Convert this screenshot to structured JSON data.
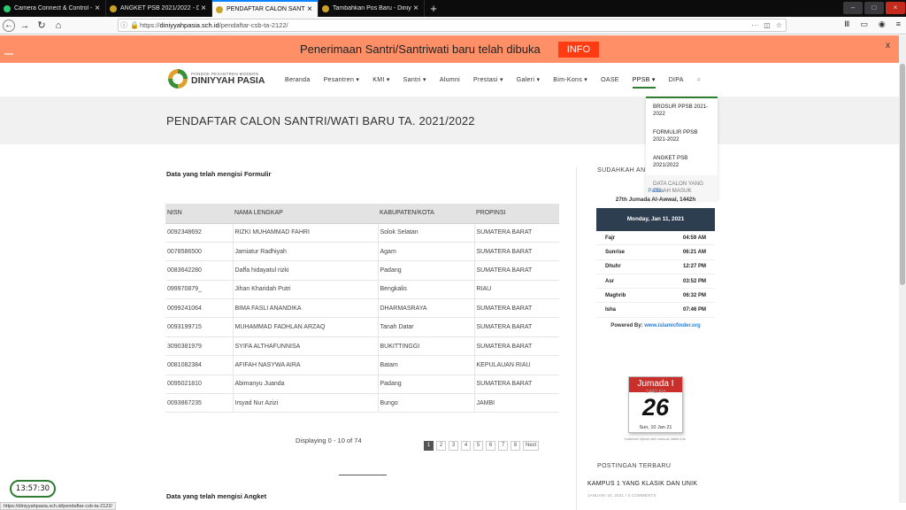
{
  "browser": {
    "tabs": [
      {
        "label": "Camera Connect & Control - A",
        "color": "#2ecc71",
        "active": false
      },
      {
        "label": "ANGKET PSB 2021/2022 - Diniy",
        "color": "#c9a227",
        "active": false
      },
      {
        "label": "PENDAFTAR CALON SANTRI/",
        "color": "#c9a227",
        "active": true
      },
      {
        "label": "Tambahkan Pos Baru - Diniyy",
        "color": "#c9a227",
        "active": false
      }
    ],
    "url_prefix": "https://",
    "url_host": "diniyyahpasia.sch.id",
    "url_path": "/pendaftar-csb-ta-2122/",
    "new_tab": "+",
    "status_url": "https://diniyyahpasia.sch.id/pendaftar-csb-ta-2122/"
  },
  "banner": {
    "text": "Penerimaan Santri/Santriwati baru telah dibuka",
    "button": "INFO",
    "close": "x"
  },
  "logo": {
    "small": "PONDOK PESANTREN MODERN",
    "big": "DINIYYAH PASIA"
  },
  "menu": [
    "Beranda",
    "Pesantren ▾",
    "KMI ▾",
    "Santri ▾",
    "Alumni",
    "Prestasi ▾",
    "Galeri ▾",
    "Bim-Kons ▾",
    "OASE",
    "PPSB ▾",
    "DIPA"
  ],
  "dropdown": [
    "BROSUR PPSB 2021-2022",
    "FORMULIR PPSB 2021-2022",
    "ANGKET PSB 2021/2022",
    "DATA CALON YANG TELAH MASUK"
  ],
  "page_title": "PENDAFTAR CALON SANTRI/WATI BARU TA. 2021/2022",
  "section_form": "Data yang telah mengisi Formulir",
  "section_angket": "Data yang telah mengisi Angket",
  "table": {
    "headers": [
      "NISN",
      "NAMA LENGKAP",
      "KABUPATEN/KOTA",
      "PROPINSI"
    ],
    "rows": [
      [
        "0092348692",
        "RIZKI MUHAMMAD FAHRI",
        "Solok Selatan",
        "SUMATERA BARAT"
      ],
      [
        "0078586500",
        "Jamiatur Radhiyah",
        "Agam",
        "SUMATERA BARAT"
      ],
      [
        "0083642280",
        "Daffa hidayatul rizki",
        "Padang",
        "SUMATERA BARAT"
      ],
      [
        "099970879_",
        "Jihan Kharidah Putri",
        "Bengkalis",
        "RIAU"
      ],
      [
        "0099241064",
        "BIMA FASLI ANANDIKA",
        "DHARMASRAYA",
        "SUMATERA BARAT"
      ],
      [
        "0093199715",
        "MUHAMMAD FADHLAN ARZAQ",
        "Tanah Datar",
        "SUMATERA BARAT"
      ],
      [
        "3090381979",
        "SYIFA ALTHAFUNNISA",
        "BUKITTINGGI",
        "SUMATERA BARAT"
      ],
      [
        "0081082384",
        "AFIFAH NASYWA AIRA",
        "Batam",
        "KEPULAUAN RIAU"
      ],
      [
        "0095021810",
        "Abimanyu Juanda",
        "Padang",
        "SUMATERA BARAT"
      ],
      [
        "0093867235",
        "Irsyad Nur Azizi",
        "Bungo",
        "JAMBI"
      ]
    ]
  },
  "displaying": "Displaying 0 - 10 of 74",
  "pager": [
    "1",
    "2",
    "3",
    "4",
    "5",
    "6",
    "7",
    "8",
    "Next"
  ],
  "pager_current": "1",
  "sidebar": {
    "heading": "SUDAHKAH AN",
    "location": "Padan",
    "hijri": "27th Jumada Al-Awwal, 1442h",
    "date": "Monday, Jan 11, 2021",
    "prayers": [
      {
        "name": "Fajr",
        "time": "04:59 AM"
      },
      {
        "name": "Sunrise",
        "time": "06:21 AM"
      },
      {
        "name": "Dhuhr",
        "time": "12:27 PM"
      },
      {
        "name": "Asr",
        "time": "03:52 PM"
      },
      {
        "name": "Maghrib",
        "time": "06:32 PM"
      },
      {
        "name": "Isha",
        "time": "07:46 PM"
      }
    ],
    "powered_label": "Powered By:",
    "powered_link": "www.islamicfinder.org",
    "calendar": {
      "month": "Jumada I",
      "year": "1442 AH",
      "day": "26",
      "foot": "Sun, 10 Jan 21",
      "caption": "Kalender hijriah oleh www.al-habib.info"
    },
    "recent_heading": "POSTINGAN TERBARU",
    "post_title": "KAMPUS 1 YANG KLASIK DAN UNIK",
    "post_meta": "JANUARI 10, 2021 / 0 COMMENTS"
  },
  "clock": "13:57:30"
}
